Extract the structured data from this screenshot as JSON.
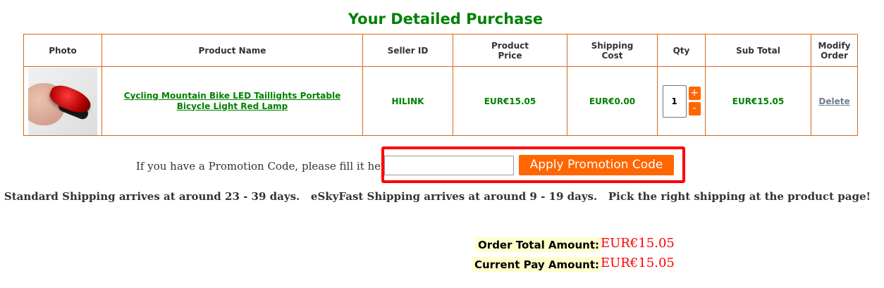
{
  "page": {
    "title": "Your Detailed Purchase"
  },
  "table": {
    "headers": {
      "photo": "Photo",
      "product_name": "Product Name",
      "seller_id": "Seller ID",
      "product_price_1": "Product",
      "product_price_2": "Price",
      "shipping_cost_1": "Shipping",
      "shipping_cost_2": "Cost",
      "qty": "Qty",
      "sub_total": "Sub Total",
      "modify_1": "Modify",
      "modify_2": "Order"
    },
    "row": {
      "photo_alt": "bike-taillight-photo",
      "product_name": "Cycling Mountain Bike LED Taillights Portable Bicycle Light Red Lamp",
      "seller_id": "HILINK",
      "product_price": "EUR€15.05",
      "shipping_cost": "EUR€0.00",
      "qty": "1",
      "qty_plus": "+",
      "qty_minus": "-",
      "sub_total": "EUR€15.05",
      "delete_label": "Delete"
    }
  },
  "promo": {
    "label": "If you have a Promotion Code, please fill it here",
    "input_value": "",
    "apply_label": "Apply Promotion Code"
  },
  "shipping_note": "Standard Shipping arrives at around 23 - 39 days.   eSkyFast Shipping arrives at around 9 - 19 days.   Pick the right shipping at the product page!",
  "totals": {
    "order_total_label": "Order Total Amount:",
    "order_total_value": "EUR€15.05",
    "current_pay_label": "Current Pay Amount:",
    "current_pay_value": "EUR€15.05"
  },
  "colors": {
    "title_green": "#008000",
    "accent_orange": "#ff6600",
    "table_border": "#d2691e",
    "highlight_red": "#ff0000",
    "total_label_bg": "#ffffcc"
  }
}
